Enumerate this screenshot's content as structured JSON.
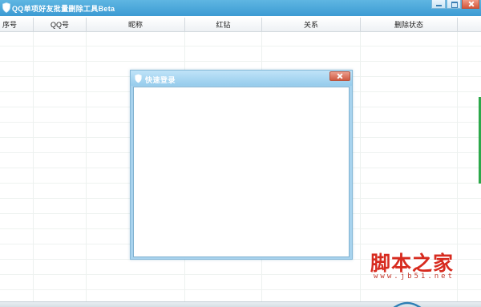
{
  "window": {
    "title": "QQ单项好友批量删除工具Beta",
    "icon": "shield-icon"
  },
  "table": {
    "columns": [
      {
        "label": "序号"
      },
      {
        "label": "QQ号"
      },
      {
        "label": "昵称"
      },
      {
        "label": "红钻"
      },
      {
        "label": "关系"
      },
      {
        "label": "删除状态"
      }
    ],
    "rows": []
  },
  "dialog": {
    "title": "快速登录",
    "icon": "shield-icon"
  },
  "watermark": {
    "text": "脚本之家",
    "url": "www.jb51.net"
  },
  "colors": {
    "titlebar": "#3c9bd3",
    "dialog_frame": "#a8d3ee",
    "close_button": "#d4573b",
    "watermark": "#d72b1f",
    "accent": "#2da84a"
  }
}
